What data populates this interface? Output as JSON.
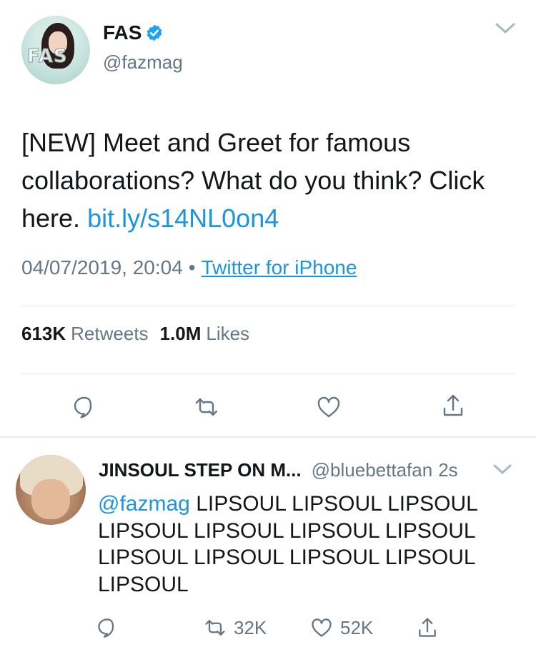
{
  "main_tweet": {
    "display_name": "FAS",
    "handle": "@fazmag",
    "avatar_logo_text": "FAS",
    "text": "[NEW] Meet and Greet for famous collaborations? What do you think? Click here.",
    "link": "bit.ly/s14NL0on4",
    "timestamp": "04/07/2019, 20:04",
    "separator": "•",
    "source": "Twitter for iPhone",
    "retweets_count": "613K",
    "retweets_label": "Retweets",
    "likes_count": "1.0M",
    "likes_label": "Likes"
  },
  "reply": {
    "display_name": "JINSOUL STEP ON M...",
    "handle": "@bluebettafan",
    "time": "2s",
    "mention": "@fazmag",
    "text": "LIPSOUL LIPSOUL LIPSOUL LIPSOUL LIPSOUL LIPSOUL LIPSOUL LIPSOUL LIPSOUL LIPSOUL LIPSOUL LIPSOUL",
    "retweet_count": "32K",
    "like_count": "52K"
  },
  "icons": {
    "verified": "verified-badge-icon",
    "caret": "chevron-down-icon",
    "reply": "reply-icon",
    "retweet": "retweet-icon",
    "like": "heart-icon",
    "share": "share-icon"
  },
  "colors": {
    "link": "#1b95e0",
    "secondary_text": "#657786",
    "primary_text": "#14171a",
    "divider": "#e1e8ed"
  }
}
